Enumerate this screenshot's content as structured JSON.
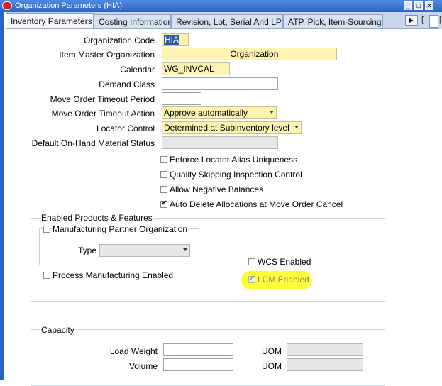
{
  "window": {
    "title": "Organization Parameters (HIA)",
    "icon": "oracle-icon",
    "right_tokens": [
      "[",
      "["
    ]
  },
  "tabs": [
    {
      "label": "Inventory Parameters",
      "active": true
    },
    {
      "label": "Costing Information",
      "active": false
    },
    {
      "label": "Revision, Lot, Serial And LPN",
      "active": false
    },
    {
      "label": "ATP, Pick, Item-Sourcing",
      "active": false
    }
  ],
  "form": {
    "organization_code": {
      "label": "Organization Code",
      "value": "HIA"
    },
    "item_master_org": {
      "label": "Item Master Organization",
      "value_tail": "Organization"
    },
    "calendar": {
      "label": "Calendar",
      "value": "WG_INVCAL"
    },
    "demand_class": {
      "label": "Demand Class",
      "value": ""
    },
    "move_order_timeout_period": {
      "label": "Move Order Timeout Period",
      "value": ""
    },
    "move_order_timeout_action": {
      "label": "Move Order Timeout Action",
      "value": "Approve automatically"
    },
    "locator_control": {
      "label": "Locator Control",
      "value": "Determined at Subinventory level"
    },
    "default_onhand_status": {
      "label": "Default On-Hand Material Status",
      "value": ""
    }
  },
  "checkboxes": {
    "enforce_locator_alias": {
      "label": "Enforce Locator Alias Uniqueness",
      "checked": false
    },
    "quality_skipping": {
      "label": "Quality Skipping Inspection Control",
      "checked": false
    },
    "allow_negative": {
      "label": "Allow Negative Balances",
      "checked": false
    },
    "auto_delete_alloc": {
      "label": "Auto Delete Allocations at Move Order Cancel",
      "checked": true
    }
  },
  "enabled_products": {
    "title": "Enabled Products & Features",
    "mfg_partner": {
      "label": "Manufacturing Partner Organization",
      "checked": false
    },
    "type_label": "Type",
    "type_value": "",
    "process_mfg": {
      "label": "Process Manufacturing Enabled",
      "checked": false
    },
    "wcs": {
      "label": "WCS Enabled",
      "checked": false
    },
    "lcm": {
      "label": "LCM Enabled",
      "checked": true,
      "highlight_color": "#ffff00"
    }
  },
  "capacity": {
    "title": "Capacity",
    "load_weight": {
      "label": "Load Weight",
      "value": "",
      "uom_label": "UOM",
      "uom_value": ""
    },
    "volume": {
      "label": "Volume",
      "value": "",
      "uom_label": "UOM",
      "uom_value": ""
    }
  },
  "colors": {
    "title_bar": "#2a63c2",
    "required_field": "#fdf3b2",
    "highlight": "#ffff00"
  }
}
